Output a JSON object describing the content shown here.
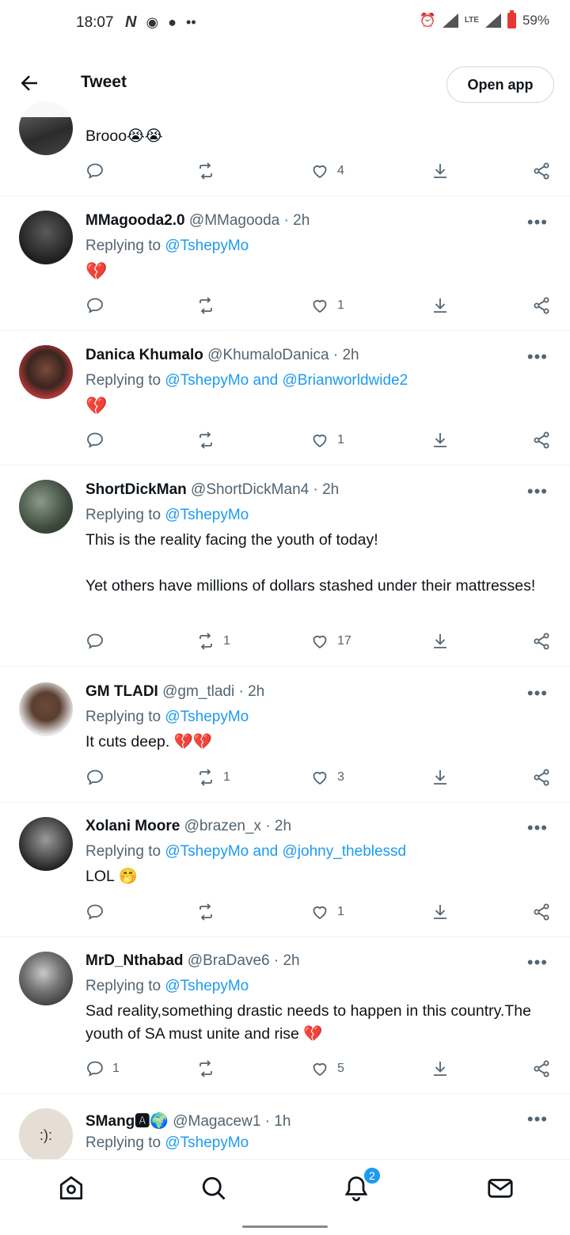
{
  "status_bar": {
    "time": "18:07",
    "battery": "59%",
    "network": "LTE",
    "left_icons": [
      "netflix-icon",
      "message-icon",
      "dot-icon",
      "more-dots-icon"
    ],
    "right_icons": [
      "alarm-icon",
      "signal-icon",
      "signal-icon",
      "battery-icon"
    ]
  },
  "top_bar": {
    "title": "Tweet",
    "open_app": "Open app"
  },
  "colors": {
    "link": "#1d9bf0",
    "secondary_text": "#536471",
    "heart_emoji": "#e0245e"
  },
  "tweets": [
    {
      "name": "",
      "handle": "",
      "time": "",
      "text": "Brooo😭😭",
      "replying_to": [],
      "replies": "",
      "retweets": "",
      "likes": "4"
    },
    {
      "name": "MMagooda2.0",
      "handle": "@MMagooda",
      "time": "2h",
      "replying_prefix": "Replying to",
      "replying_to": [
        "@TshepyMo"
      ],
      "text": "💔",
      "replies": "",
      "retweets": "",
      "likes": "1"
    },
    {
      "name": "Danica Khumalo",
      "handle": "@KhumaloDanica",
      "time": "2h",
      "replying_prefix": "Replying to",
      "replying_to": [
        "@TshepyMo",
        "@Brianworldwide2"
      ],
      "text": "💔",
      "replies": "",
      "retweets": "",
      "likes": "1"
    },
    {
      "name": "ShortDickMan",
      "handle": "@ShortDickMan4",
      "time": "2h",
      "replying_prefix": "Replying to",
      "replying_to": [
        "@TshepyMo"
      ],
      "text": "This is the reality facing the youth of today!\n\nYet others have millions of dollars stashed under their mattresses!",
      "replies": "",
      "retweets": "1",
      "likes": "17"
    },
    {
      "name": "GM TLADI",
      "handle": "@gm_tladi",
      "time": "2h",
      "replying_prefix": "Replying to",
      "replying_to": [
        "@TshepyMo"
      ],
      "text": "It cuts deep. 💔💔",
      "replies": "",
      "retweets": "1",
      "likes": "3"
    },
    {
      "name": "Xolani Moore",
      "handle": "@brazen_x",
      "time": "2h",
      "replying_prefix": "Replying to",
      "replying_to": [
        "@TshepyMo",
        "@johny_theblessd"
      ],
      "text": "LOL 🤭",
      "replies": "",
      "retweets": "",
      "likes": "1"
    },
    {
      "name": "MrD_Nthabad",
      "handle": "@BraDave6",
      "time": "2h",
      "replying_prefix": "Replying to",
      "replying_to": [
        "@TshepyMo"
      ],
      "text": "Sad reality,something drastic needs to happen in this country.The youth of SA must unite  and rise 💔",
      "replies": "1",
      "retweets": "",
      "likes": "5"
    },
    {
      "name": "SMang🅰🌍",
      "handle": "@Magacew1",
      "time": "1h",
      "replying_prefix": "Replying to",
      "replying_to": [
        "@TshepyMo"
      ],
      "text": "",
      "replies": "",
      "retweets": "",
      "likes": ""
    }
  ],
  "conjunction": "and",
  "dot": "·",
  "bottom_nav": {
    "items": [
      "home-icon",
      "search-icon",
      "notifications-icon",
      "messages-icon"
    ],
    "notification_count": "2"
  }
}
